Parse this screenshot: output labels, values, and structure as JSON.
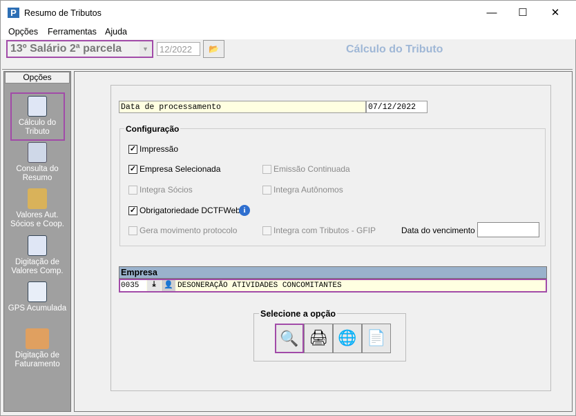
{
  "window": {
    "title": "Resumo de Tributos",
    "minimize": "—",
    "maximize": "☐",
    "close": "✕"
  },
  "menu": [
    "Opções",
    "Ferramentas",
    "Ajuda"
  ],
  "toolbar": {
    "type": "13º Salário 2ª parcela",
    "period": "12/2022",
    "heading": "Cálculo do Tributo"
  },
  "sidebar": {
    "header": "Opções",
    "items": [
      {
        "label": "Cálculo do Tributo",
        "icon": "calc-doc-icon"
      },
      {
        "label": "Consulta do Resumo",
        "icon": "computer-icon"
      },
      {
        "label": "Valores Aut. Sócios e Coop.",
        "icon": "people-icon"
      },
      {
        "label": "Digitação de Valores Comp.",
        "icon": "edit-doc-icon"
      },
      {
        "label": "GPS Acumulada",
        "icon": "gps-doc-icon"
      },
      {
        "label": "Digitação de Faturamento",
        "icon": "laptop-icon"
      }
    ]
  },
  "form": {
    "processing_label": "Data de processamento",
    "processing_date": "07/12/2022",
    "config_title": "Configuração",
    "checkboxes": [
      {
        "label": "Impressão",
        "checked": true,
        "enabled": true
      },
      {
        "label": "Empresa Selecionada",
        "checked": true,
        "enabled": true
      },
      {
        "label": "Emissão Continuada",
        "checked": false,
        "enabled": false
      },
      {
        "label": "Integra Sócios",
        "checked": false,
        "enabled": false
      },
      {
        "label": "Integra Autônomos",
        "checked": false,
        "enabled": false
      },
      {
        "label": "Obrigatoriedade DCTFWeb",
        "checked": true,
        "enabled": true
      },
      {
        "label": "Gera movimento protocolo",
        "checked": false,
        "enabled": false
      },
      {
        "label": "Integra com Tributos - GFIP",
        "checked": false,
        "enabled": false
      }
    ],
    "due_date_label": "Data do vencimento",
    "due_date": "",
    "company_header": "Empresa",
    "company_code": "0035",
    "company_name": "DESONERAÇÃO ATIVIDADES CONCOMITANTES",
    "select_title": "Selecione a opção"
  },
  "accent": "#a14aa8"
}
